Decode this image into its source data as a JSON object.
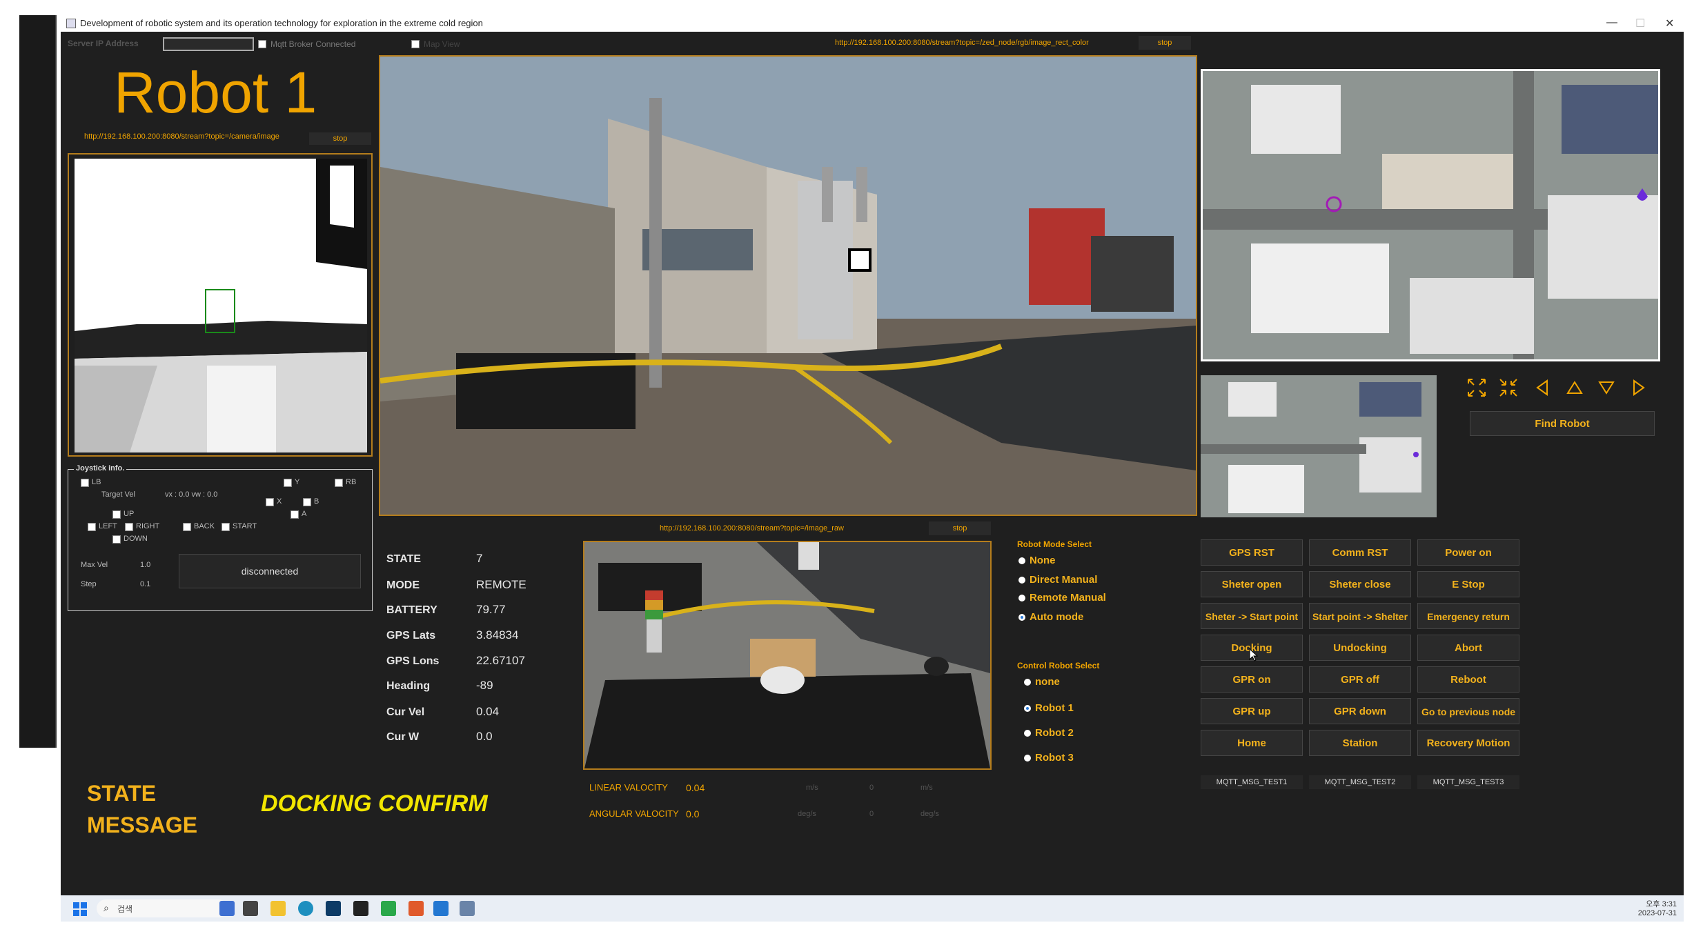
{
  "window": {
    "title": "Development of robotic system and its operation technology for exploration in the extreme cold region",
    "min": "—",
    "max": "☐",
    "close": "✕"
  },
  "header": {
    "server_ip_label": "Server IP Address",
    "mqtt_label": "Mqtt Broker Connected",
    "map_view_label": "Map View",
    "main_stream_url": "http://192.168.100.200:8080/stream?topic=/zed_node/rgb/image_rect_color",
    "main_stream_stop": "stop"
  },
  "robot_title": "Robot 1",
  "left_stream": {
    "url": "http://192.168.100.200:8080/stream?topic=/camera/image",
    "stop": "stop"
  },
  "joystick": {
    "title": "Joystick info.",
    "lb": "LB",
    "y": "Y",
    "rb": "RB",
    "target_vel": "Target Vel",
    "vx": "vx : 0.0 vw : 0.0",
    "x": "X",
    "b": "B",
    "up": "UP",
    "a": "A",
    "left": "LEFT",
    "right": "RIGHT",
    "back": "BACK",
    "start": "START",
    "down": "DOWN",
    "max_vel_label": "Max Vel",
    "max_vel": "1.0",
    "step_label": "Step",
    "step": "0.1",
    "status": "disconnected"
  },
  "status": {
    "items": [
      {
        "label": "STATE",
        "value": "7"
      },
      {
        "label": "MODE",
        "value": "REMOTE"
      },
      {
        "label": "BATTERY",
        "value": "79.77"
      },
      {
        "label": "GPS Lats",
        "value": "3.84834"
      },
      {
        "label": "GPS Lons",
        "value": "22.67107"
      },
      {
        "label": "Heading",
        "value": "-89"
      },
      {
        "label": "Cur Vel",
        "value": "0.04"
      },
      {
        "label": "Cur W",
        "value": "0.0"
      }
    ]
  },
  "state_message": {
    "label_line1": "STATE",
    "label_line2": "MESSAGE",
    "text": "DOCKING CONFIRM"
  },
  "bottom_stream": {
    "url": "http://192.168.100.200:8080/stream?topic=/image_raw",
    "stop": "stop"
  },
  "velocity": {
    "linear_label": "LINEAR VALOCITY",
    "linear_value": "0.04",
    "linear_unit": "m/s",
    "linear_zero": "0",
    "linear_unit2": "m/s",
    "angular_label": "ANGULAR VALOCITY",
    "angular_value": "0.0",
    "angular_unit": "deg/s",
    "angular_zero": "0",
    "angular_unit2": "deg/s"
  },
  "robot_mode": {
    "title": "Robot Mode Select",
    "options": [
      "None",
      "Direct Manual",
      "Remote Manual",
      "Auto mode"
    ],
    "selected": 3
  },
  "control_robot": {
    "title": "Control Robot Select",
    "options": [
      "none",
      "Robot 1",
      "Robot 2",
      "Robot 3"
    ],
    "selected": 1
  },
  "command_buttons": [
    [
      "GPS RST",
      "Comm RST",
      "Power on"
    ],
    [
      "Sheter open",
      "Sheter close",
      "E Stop"
    ],
    [
      "Sheter -> Start point",
      "Start point -> Shelter",
      "Emergency return"
    ],
    [
      "Docking",
      "Undocking",
      "Abort"
    ],
    [
      "GPR on",
      "GPR off",
      "Reboot"
    ],
    [
      "GPR up",
      "GPR down",
      "Go to previous node"
    ],
    [
      "Home",
      "Station",
      "Recovery Motion"
    ]
  ],
  "mqtt_buttons": [
    "MQTT_MSG_TEST1",
    "MQTT_MSG_TEST2",
    "MQTT_MSG_TEST3"
  ],
  "map": {
    "find_robot": "Find Robot"
  },
  "taskbar": {
    "search": "검색",
    "time": "오후 3:31",
    "date": "2023-07-31"
  }
}
